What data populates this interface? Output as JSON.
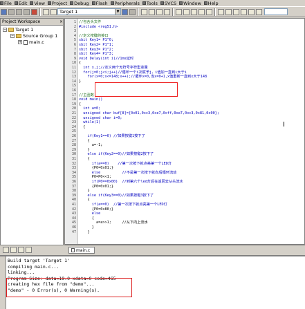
{
  "menubar": {
    "items": [
      "File",
      "Edit",
      "View",
      "Project",
      "Debug",
      "Flash",
      "Peripherals",
      "Tools",
      "SVCS",
      "Window",
      "Help"
    ]
  },
  "toolbar": {
    "target": "Target 1"
  },
  "workspace": {
    "title": "Project Workspace",
    "close": "×",
    "tree": {
      "target": "Target 1",
      "group": "Source Group 1",
      "file": "main.c"
    }
  },
  "editor": {
    "tab": "main.c",
    "lines": [
      {
        "n": "1",
        "text": "//包含头文件"
      },
      {
        "n": "2",
        "text": "#include <reg51.h>"
      },
      {
        "n": "3",
        "text": ""
      },
      {
        "n": "4",
        "text": "//定义按键的接口"
      },
      {
        "n": "5",
        "text": "sbit Key1= P1^0;"
      },
      {
        "n": "6",
        "text": "sbit Key2= P1^1;"
      },
      {
        "n": "7",
        "text": "sbit Key3= P1^2;"
      },
      {
        "n": "8",
        "text": "sbit Key4= P1^3;"
      },
      {
        "n": "9",
        "text": "void Delay(int i)//1ms延时"
      },
      {
        "n": "10",
        "text": "{"
      },
      {
        "n": "11",
        "text": "  int x,j;//定义两个无符号字符型变量"
      },
      {
        "n": "12",
        "text": "  for(j=0;j<i;j++)//循环一个i次赋予j，i值加一直到i大于i"
      },
      {
        "n": "13",
        "text": "    for(x=0;x<=148;x++);//循环x=0,当x=0+1,x值重新一直到x大于148"
      },
      {
        "n": "14",
        "text": "}"
      },
      {
        "n": "15",
        "text": ""
      },
      {
        "n": "16",
        "text": ""
      },
      {
        "n": "17",
        "text": "//主函数"
      },
      {
        "n": "18",
        "text": "void main()"
      },
      {
        "n": "19",
        "text": "{"
      },
      {
        "n": "20",
        "text": "  int a=0;"
      },
      {
        "n": "21",
        "text": "  unsigned char buf[8]={0x01,0xc3,0xe7,0xff,0xe7,0xc3,0x81,0x00};"
      },
      {
        "n": "22",
        "text": "  unsigned char i=0;"
      },
      {
        "n": "23",
        "text": "  while(1)"
      },
      {
        "n": "24",
        "text": "  {"
      },
      {
        "n": "25",
        "text": ""
      },
      {
        "n": "26",
        "text": "    if(Key1==0) //如果按键1按下了"
      },
      {
        "n": "27",
        "text": "    {"
      },
      {
        "n": "28",
        "text": "      a=-1;"
      },
      {
        "n": "29",
        "text": "    }"
      },
      {
        "n": "30",
        "text": "    else if(Key2==0)//如果按键2按下了"
      },
      {
        "n": "31",
        "text": "    {"
      },
      {
        "n": "32",
        "text": "      if(a==0)    //第一次按下就点亮第一个LED灯"
      },
      {
        "n": "33",
        "text": "      {P0=0x01;}"
      },
      {
        "n": "34",
        "text": "      else          //不是第一次按下就向后循环流动"
      },
      {
        "n": "35",
        "text": "      P0=P0<<1;"
      },
      {
        "n": "36",
        "text": "      if(P0==0x00)  //到第六个led灯后在返回去从头流水"
      },
      {
        "n": "37",
        "text": "      {P0=0x01;}"
      },
      {
        "n": "38",
        "text": "    }"
      },
      {
        "n": "39",
        "text": "    else if(Key3==0)//如果按键3按下了"
      },
      {
        "n": "40",
        "text": "    {"
      },
      {
        "n": "41",
        "text": "      if(a==0)  //第一次按下就点亮第一个LED灯"
      },
      {
        "n": "42",
        "text": "      {P0=0x80;}"
      },
      {
        "n": "43",
        "text": "      else"
      },
      {
        "n": "44",
        "text": "      {"
      },
      {
        "n": "45",
        "text": "        a=a>>1;     //从下向上流水"
      },
      {
        "n": "46",
        "text": "      }"
      },
      {
        "n": "47",
        "text": "    }"
      }
    ]
  },
  "output": {
    "lines": [
      "Build target 'Target 1'",
      "compiling main.c...",
      "linking...",
      "Program Size: data=19.0 xdata=0 code=465",
      "creating hex file from \"demo\"...",
      "\"demo\" - 0 Error(s), 0 Warning(s)."
    ]
  }
}
